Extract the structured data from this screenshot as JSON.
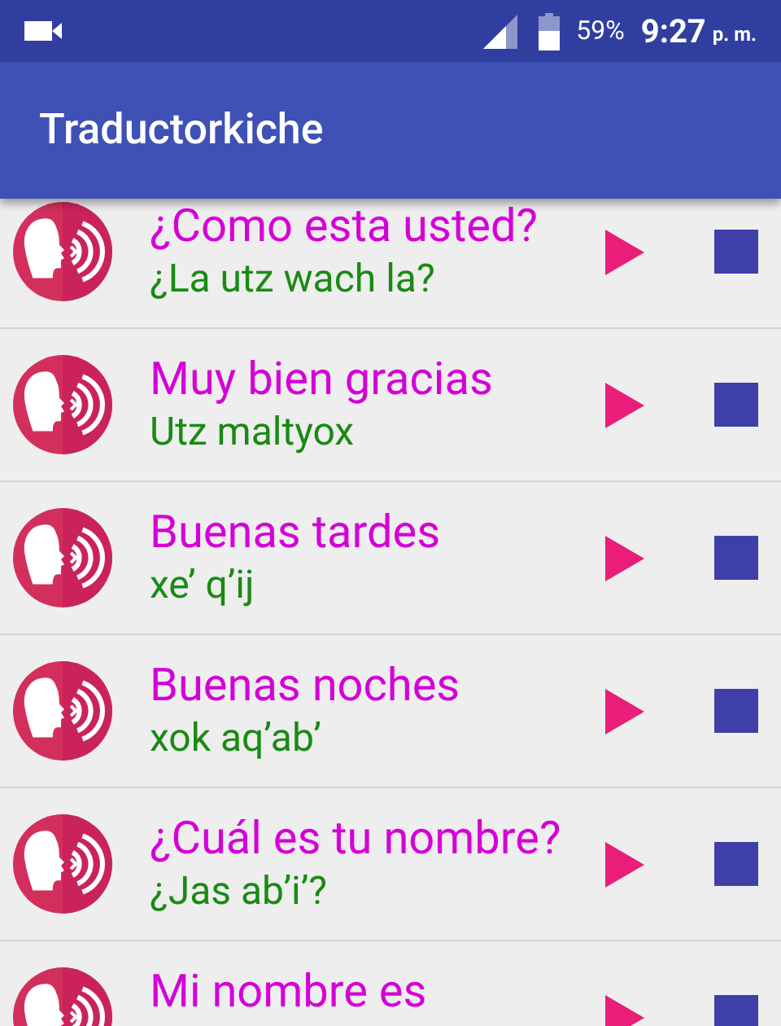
{
  "status_bar": {
    "battery": "59%",
    "time": "9:27",
    "period": "p. m."
  },
  "app_bar": {
    "title": "Traductorkiche"
  },
  "phrases": [
    {
      "spanish": "¿Como esta usted?",
      "kiche": "¿La utz wach la?"
    },
    {
      "spanish": "Muy bien gracias",
      "kiche": "Utz maltyox"
    },
    {
      "spanish": "Buenas tardes",
      "kiche": "xe’ q’ij"
    },
    {
      "spanish": "Buenas noches",
      "kiche": "xok aq’ab’"
    },
    {
      "spanish": "¿Cuál es tu nombre?",
      "kiche": "¿Jas ab’i’?"
    },
    {
      "spanish": "Mi nombre es"
    }
  ]
}
